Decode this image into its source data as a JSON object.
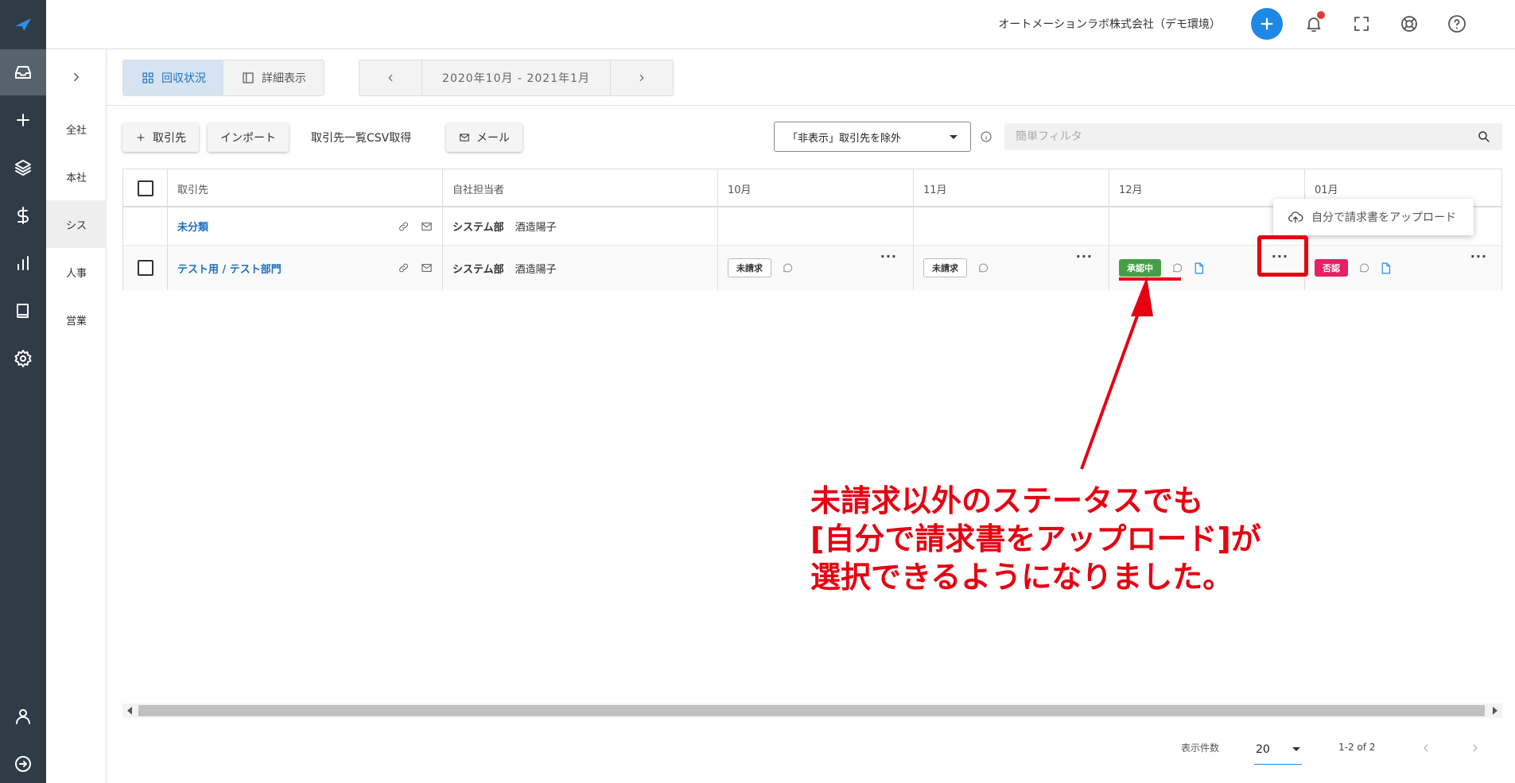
{
  "topbar": {
    "company": "オートメーションラボ株式会社（デモ環境）"
  },
  "departments": [
    {
      "label": "全社"
    },
    {
      "label": "本社"
    },
    {
      "label": "シス"
    },
    {
      "label": "人事"
    },
    {
      "label": "営業"
    }
  ],
  "view_toggle": {
    "status_label": "回収状況",
    "detail_label": "詳細表示"
  },
  "period": {
    "label": "2020年10月 - 2021年1月"
  },
  "toolbar": {
    "add_partner": "取引先",
    "import": "インポート",
    "csv": "取引先一覧CSV取得",
    "mail": "メール",
    "filter_select": "「非表示」取引先を除外",
    "search_placeholder": "簡単フィルタ"
  },
  "table": {
    "headers": {
      "partner": "取引先",
      "owner": "自社担当者",
      "m1": "10月",
      "m2": "11月",
      "m3": "12月",
      "m4": "01月"
    },
    "rows": [
      {
        "partner": "未分類",
        "owner_dept": "システム部",
        "owner_name": "酒造陽子"
      },
      {
        "partner": "テスト用 / テスト部門",
        "owner_dept": "システム部",
        "owner_name": "酒造陽子",
        "m1": "未請求",
        "m2": "未請求",
        "m3": "承認中",
        "m4": "否認"
      }
    ]
  },
  "menu": {
    "upload_self": "自分で請求書をアップロード"
  },
  "annotation": {
    "text": "未請求以外のステータスでも\n[自分で請求書をアップロード]が\n選択できるようになりました。"
  },
  "pagination": {
    "rows_label": "表示件数",
    "rows_value": "20",
    "range": "1-2 of 2"
  },
  "colors": {
    "accent": "#1e88e5",
    "sidebar": "#2f3b47",
    "status_green": "#43a047",
    "status_red": "#e91e63",
    "annotation_red": "#e60012"
  }
}
